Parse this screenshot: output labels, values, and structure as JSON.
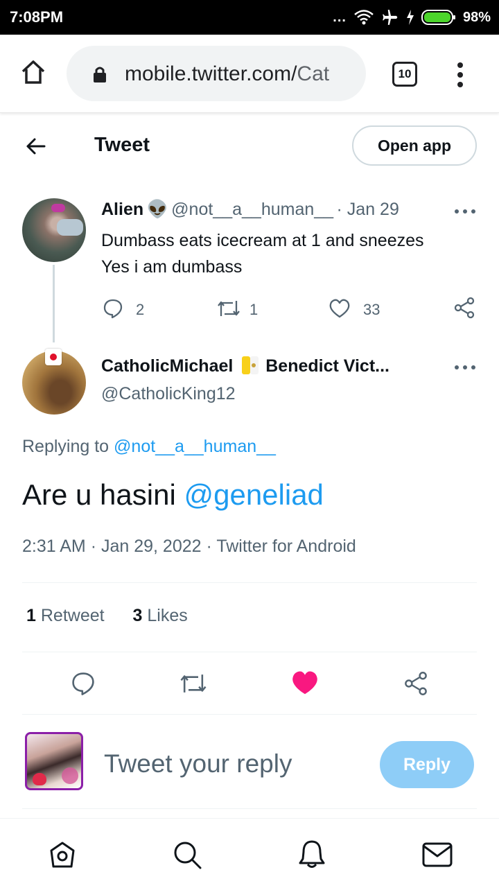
{
  "status_bar": {
    "time": "7:08PM",
    "battery": "98%",
    "dots": "..."
  },
  "browser": {
    "url_host": "mobile.twitter.com/",
    "url_path": "Cat",
    "tab_count": "10"
  },
  "header": {
    "title": "Tweet",
    "open_app": "Open app"
  },
  "parent_tweet": {
    "name": "Alien",
    "emoji": "👽",
    "handle": "@not__a__human__",
    "date": "· Jan 29",
    "lines": [
      "Dumbass eats icecream at 1 and sneezes",
      "Yes i am dumbass"
    ],
    "replies": "2",
    "retweets": "1",
    "likes": "33"
  },
  "main_tweet": {
    "name": "CatholicMichael",
    "name_suffix": "Benedict Vict...",
    "handle": "@CatholicKing12",
    "replying_prefix": "Replying to ",
    "replying_handle": "@not__a__human__",
    "text": "Are u hasini ",
    "mention": "@geneliad",
    "time": "2:31 AM",
    "date": "Jan 29, 2022",
    "source": "Twitter for Android",
    "separator": "·",
    "retweet_count": "1",
    "retweet_label": "Retweet",
    "like_count": "3",
    "like_label": "Likes"
  },
  "reply_box": {
    "placeholder": "Tweet your reply",
    "button": "Reply"
  },
  "colors": {
    "accent": "#1d9bf0",
    "like": "#f91880",
    "reply_button": "#8ecdf7"
  }
}
